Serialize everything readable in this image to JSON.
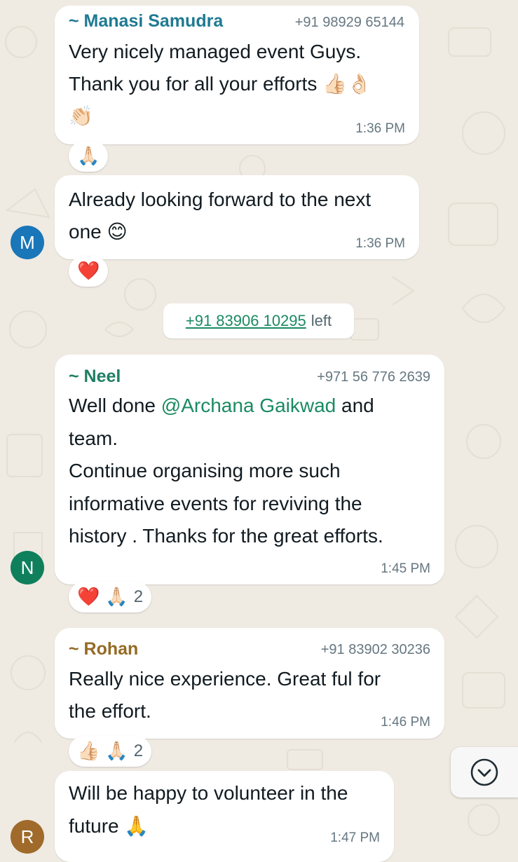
{
  "colors": {
    "background": "#efeae2",
    "bubble": "#ffffff",
    "name_manasi": "#1f7a92",
    "name_neel": "#1e7f63",
    "name_rohan": "#946a24",
    "avatar_m": "#1976b8",
    "avatar_n": "#0f7f5c",
    "avatar_r": "#a06a2a",
    "timestamp": "#667781",
    "mention": "#1a8a62"
  },
  "messages": [
    {
      "sender": "~ Manasi Samudra",
      "phone": "+91 98929 65144",
      "lines": [
        "Very nicely managed event Guys.",
        "Thank you for all your efforts 👍🏻👌🏻",
        "👏🏻"
      ],
      "time": "1:36 PM",
      "reactions": [
        "🙏🏻"
      ]
    },
    {
      "lines": [
        "Already looking forward to the next",
        "one 😊"
      ],
      "time": "1:36 PM",
      "avatar_letter": "M",
      "reactions": [
        "❤️"
      ]
    },
    {
      "sender": "~ Neel",
      "phone": "+971 56 776 2639",
      "line1_before": "Well done ",
      "mention": "@Archana Gaikwad",
      "line1_after": " and",
      "lines": [
        "team.",
        "Continue organising more such",
        "informative  events for reviving the",
        "history . Thanks for the great efforts."
      ],
      "time": "1:45 PM",
      "avatar_letter": "N",
      "reactions": [
        "❤️",
        "🙏🏻"
      ],
      "reaction_count": "2"
    },
    {
      "sender": "~ Rohan",
      "phone": "+91 83902 30236",
      "lines": [
        "Really nice experience. Great ful for",
        "the effort."
      ],
      "time": "1:46 PM",
      "reactions": [
        "👍🏻",
        "🙏🏻"
      ],
      "reaction_count": "2"
    },
    {
      "lines": [
        "Will be happy to volunteer in the",
        "future 🙏"
      ],
      "time": "1:47 PM",
      "avatar_letter": "R"
    }
  ],
  "system": {
    "phone": "+91 83906 10295",
    "text": "left"
  },
  "scroll_button": {
    "icon": "chevron-down-icon"
  }
}
